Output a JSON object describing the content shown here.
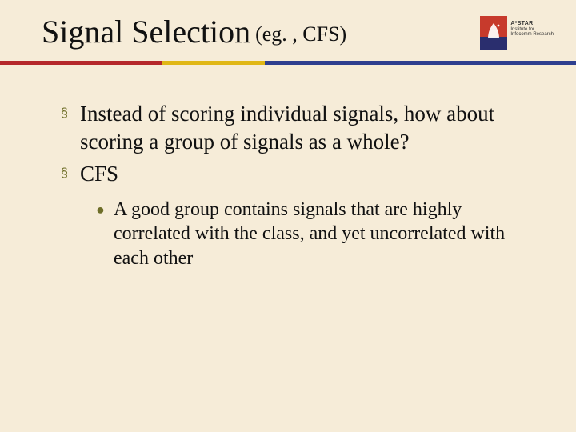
{
  "title": {
    "main": "Signal Selection",
    "sub": "(eg. , CFS)"
  },
  "logo": {
    "line1": "A*STAR",
    "line2": "Institute for",
    "line3": "Infocomm Research"
  },
  "bullets": [
    {
      "text": "Instead of scoring individual signals, how about scoring a group of signals as a whole?"
    },
    {
      "text": "CFS",
      "sub": [
        {
          "text": "A good group contains signals that are highly correlated with the class, and yet uncorrelated with each other"
        }
      ]
    }
  ]
}
